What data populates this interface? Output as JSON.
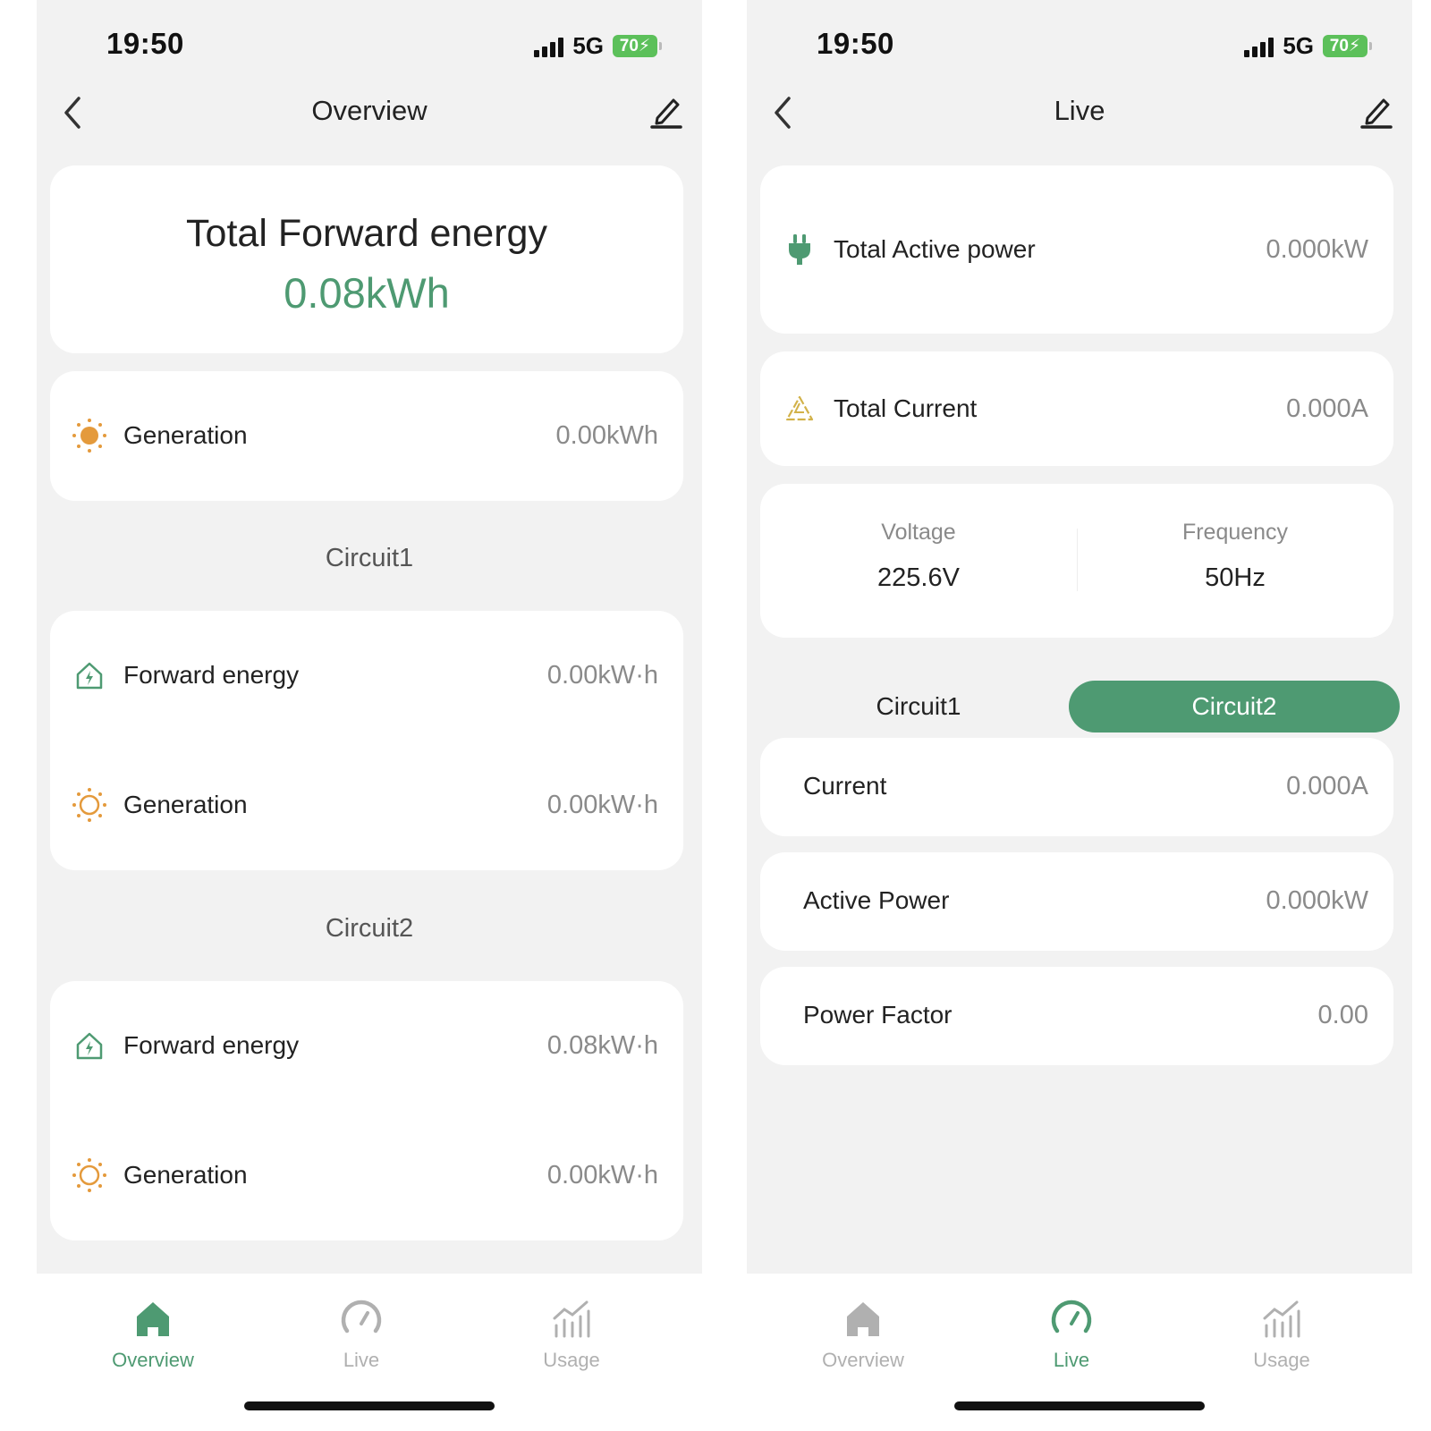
{
  "status_bar": {
    "time": "19:50",
    "network": "5G",
    "battery": "70"
  },
  "colors": {
    "accent": "#4e9a72",
    "sun": "#e49a3c",
    "warning": "#d2b24a"
  },
  "overview": {
    "nav_title": "Overview",
    "total": {
      "title": "Total Forward energy",
      "value": "0.08kWh"
    },
    "generation": {
      "label": "Generation",
      "value": "0.00kWh"
    },
    "circuits": [
      {
        "title": "Circuit1",
        "forward_label": "Forward energy",
        "forward_value": "0.00kW·h",
        "generation_label": "Generation",
        "generation_value": "0.00kW·h"
      },
      {
        "title": "Circuit2",
        "forward_label": "Forward energy",
        "forward_value": "0.08kW·h",
        "generation_label": "Generation",
        "generation_value": "0.00kW·h"
      }
    ]
  },
  "live": {
    "nav_title": "Live",
    "total_active_power": {
      "label": "Total Active power",
      "value": "0.000kW"
    },
    "total_current": {
      "label": "Total Current",
      "value": "0.000A"
    },
    "voltage": {
      "label": "Voltage",
      "value": "225.6V"
    },
    "frequency": {
      "label": "Frequency",
      "value": "50Hz"
    },
    "segments": {
      "circuit1": "Circuit1",
      "circuit2": "Circuit2",
      "selected": "Circuit2"
    },
    "current": {
      "label": "Current",
      "value": "0.000A"
    },
    "active_power": {
      "label": "Active Power",
      "value": "0.000kW"
    },
    "power_factor": {
      "label": "Power Factor",
      "value": "0.00"
    }
  },
  "tabs": {
    "overview": "Overview",
    "live": "Live",
    "usage": "Usage"
  }
}
